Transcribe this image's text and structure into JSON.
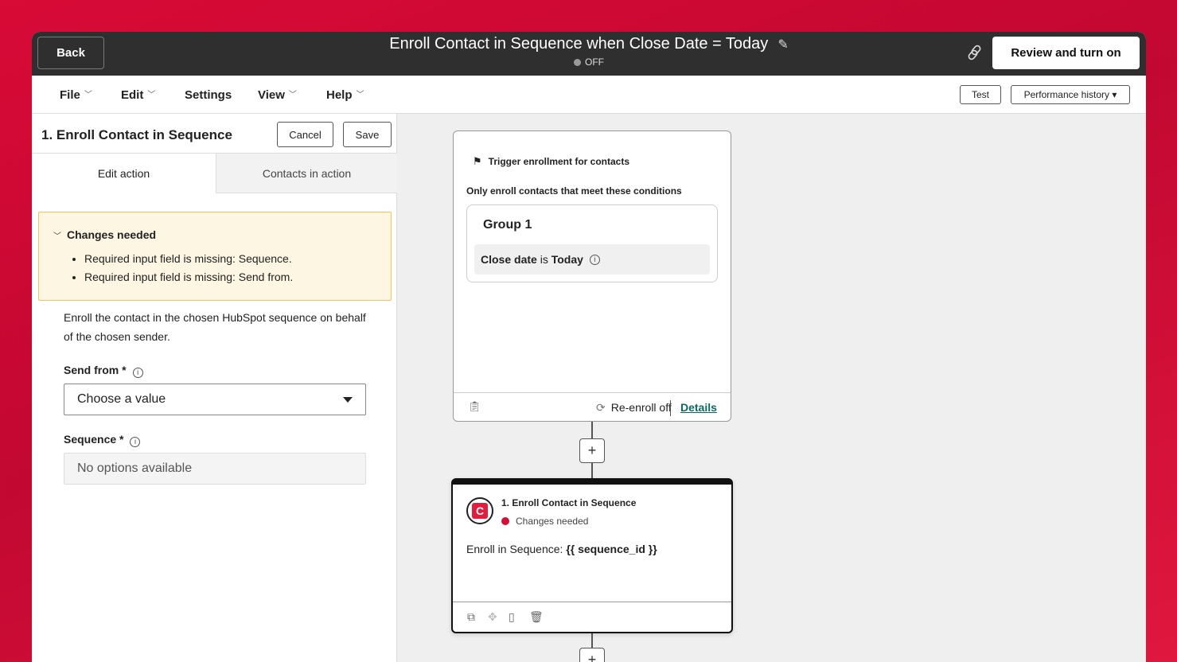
{
  "header": {
    "back_label": "Back",
    "workflow_title": "Enroll Contact in Sequence when Close Date = Today",
    "status": "OFF",
    "review_label": "Review and turn on"
  },
  "menubar": {
    "file": "File",
    "edit": "Edit",
    "settings": "Settings",
    "view": "View",
    "help": "Help",
    "test_label": "Test",
    "perf_label": "Performance history ▾"
  },
  "panel": {
    "title": "1. Enroll Contact in Sequence",
    "cancel_label": "Cancel",
    "save_label": "Save",
    "tabs": [
      "Edit action",
      "Contacts in action"
    ],
    "alert": {
      "heading": "Changes needed",
      "items": [
        "Required input field is missing: Sequence.",
        "Required input field is missing: Send from."
      ]
    },
    "description": "Enroll the contact in the chosen HubSpot sequence on behalf of the chosen sender.",
    "send_from_label": "Send from *",
    "send_from_value": "Choose a value",
    "sequence_label": "Sequence *",
    "sequence_value": "No options available"
  },
  "trigger": {
    "title": "Trigger enrollment for contacts",
    "subtitle": "Only enroll contacts that meet these conditions",
    "group_title": "Group 1",
    "condition_property": "Close date",
    "condition_operator": "is",
    "condition_value": "Today",
    "reenroll": "Re-enroll off",
    "details": "Details"
  },
  "action": {
    "title": "1. Enroll Contact in Sequence",
    "status": "Changes needed",
    "status_color": "#d40f35",
    "body_prefix": "Enroll in Sequence:",
    "body_token": "{{ sequence_id }}"
  },
  "colors": {
    "background": "#c8082f",
    "topbar": "#2f2f2f",
    "alert_bg": "#fdf6e3",
    "alert_border": "#f0c65a",
    "link": "#0b6a63"
  }
}
